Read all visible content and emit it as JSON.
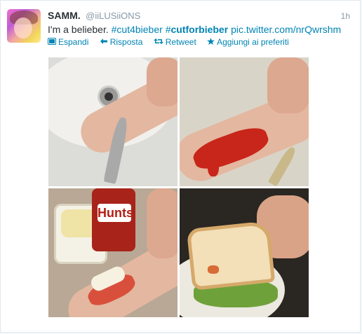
{
  "tweet": {
    "display_name": "SAMM.",
    "handle": "@iiLUSiiONS",
    "timestamp": "1h",
    "text_plain": "I'm a belieber. ",
    "hashtag1": "#cut4bieber",
    "hashtag2_prefix": "#",
    "hashtag2_word": "cutforbieber",
    "link": "pic.twitter.com/nrQwrshm"
  },
  "actions": {
    "expand": "Espandi",
    "reply": "Risposta",
    "retweet": "Retweet",
    "favorite": "Aggiungi ai preferiti"
  },
  "media": {
    "bottle_label": "Hunts"
  },
  "colors": {
    "link": "#0084b4",
    "text": "#292f33",
    "muted": "#8899a6"
  },
  "icons": {
    "expand": "media-icon",
    "reply": "reply-arrow-icon",
    "retweet": "retweet-icon",
    "favorite": "star-icon"
  }
}
